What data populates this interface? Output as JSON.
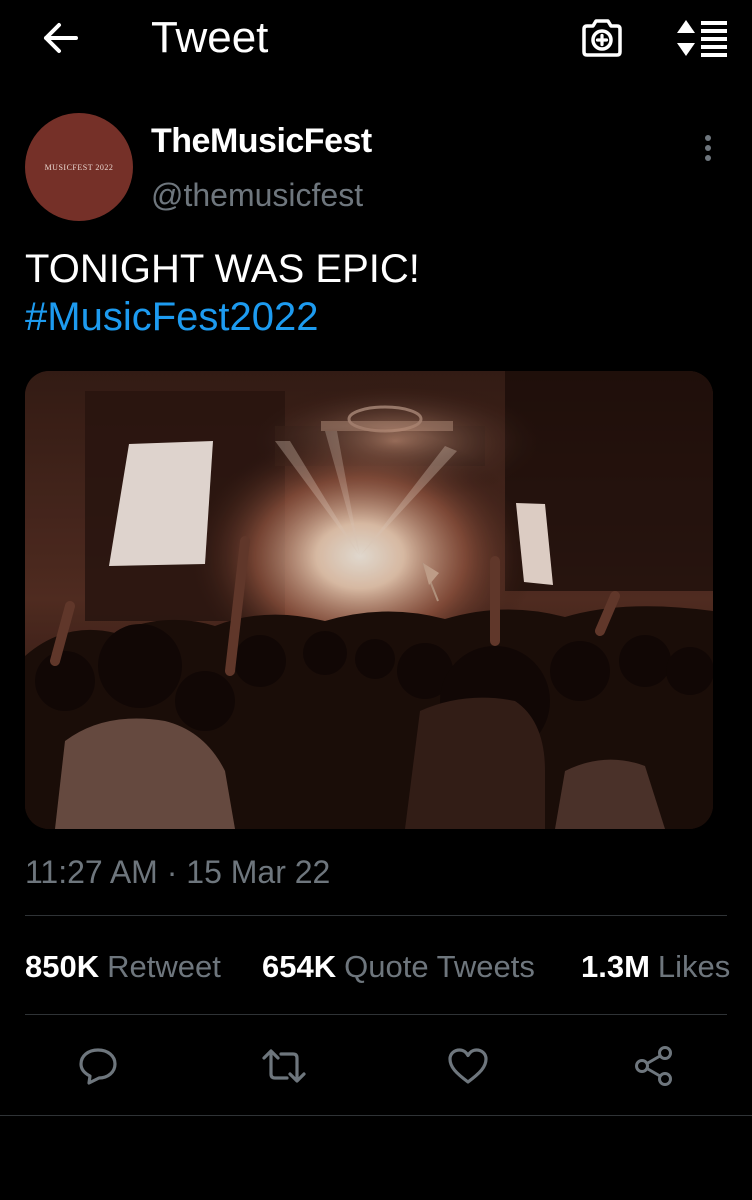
{
  "header": {
    "title": "Tweet",
    "back_icon": "arrow-left-icon",
    "camera_icon": "camera-add-icon",
    "sort_icon": "sort-lines-icon"
  },
  "author": {
    "name": "TheMusicFest",
    "handle": "@themusicfest",
    "avatar_text": "MUSICFEST 2022",
    "avatar_color": "#753028"
  },
  "tweet": {
    "text": "TONIGHT WAS EPIC!",
    "hashtag": "#MusicFest2022",
    "media_description": "Concert crowd photo",
    "timestamp": "11:27 AM · 15 Mar 22"
  },
  "stats": [
    {
      "count": "850K",
      "label": "Retweet"
    },
    {
      "count": "654K",
      "label": "Quote Tweets"
    },
    {
      "count": "1.3M",
      "label": "Likes"
    }
  ],
  "actions": [
    "reply-icon",
    "retweet-icon",
    "like-icon",
    "share-icon"
  ],
  "colors": {
    "background": "#000000",
    "text": "#ffffff",
    "secondary_text": "#6e767d",
    "accent": "#1d9bf0",
    "divider": "#2f3336"
  }
}
